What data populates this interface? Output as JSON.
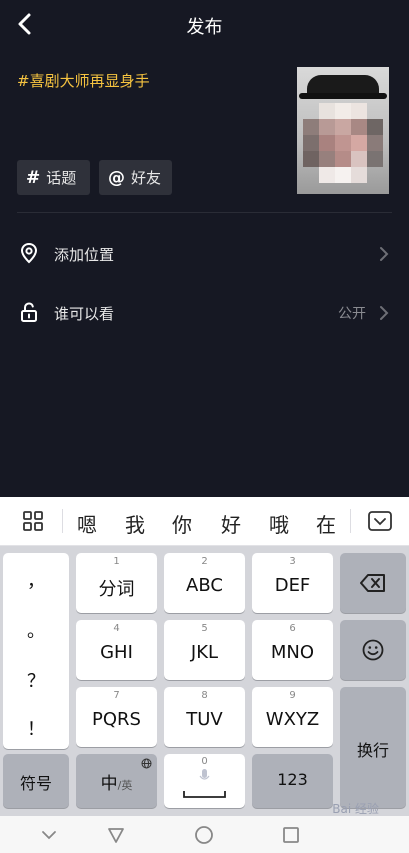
{
  "header": {
    "title": "发布"
  },
  "post": {
    "caption": "#喜剧大师再显身手",
    "chips": {
      "topic_symbol": "#",
      "topic_label": "话题",
      "friend_symbol": "@",
      "friend_label": "好友"
    }
  },
  "settings": {
    "location_label": "添加位置",
    "privacy_label": "谁可以看",
    "privacy_value": "公开"
  },
  "candidates": [
    "嗯",
    "我",
    "你",
    "好",
    "哦",
    "在"
  ],
  "keyboard": {
    "punctuation": [
      "，",
      "。",
      "？",
      "！"
    ],
    "keys": [
      {
        "num": "1",
        "label": "分词"
      },
      {
        "num": "2",
        "label": "ABC"
      },
      {
        "num": "3",
        "label": "DEF"
      },
      {
        "num": "4",
        "label": "GHI"
      },
      {
        "num": "5",
        "label": "JKL"
      },
      {
        "num": "6",
        "label": "MNO"
      },
      {
        "num": "7",
        "label": "PQRS"
      },
      {
        "num": "8",
        "label": "TUV"
      },
      {
        "num": "9",
        "label": "WXYZ"
      }
    ],
    "symbol_label": "符号",
    "lang_main": "中",
    "lang_sub": "/英",
    "space_num": "0",
    "num_label": "123",
    "enter_label": "换行"
  },
  "watermark": "Bai 经验"
}
